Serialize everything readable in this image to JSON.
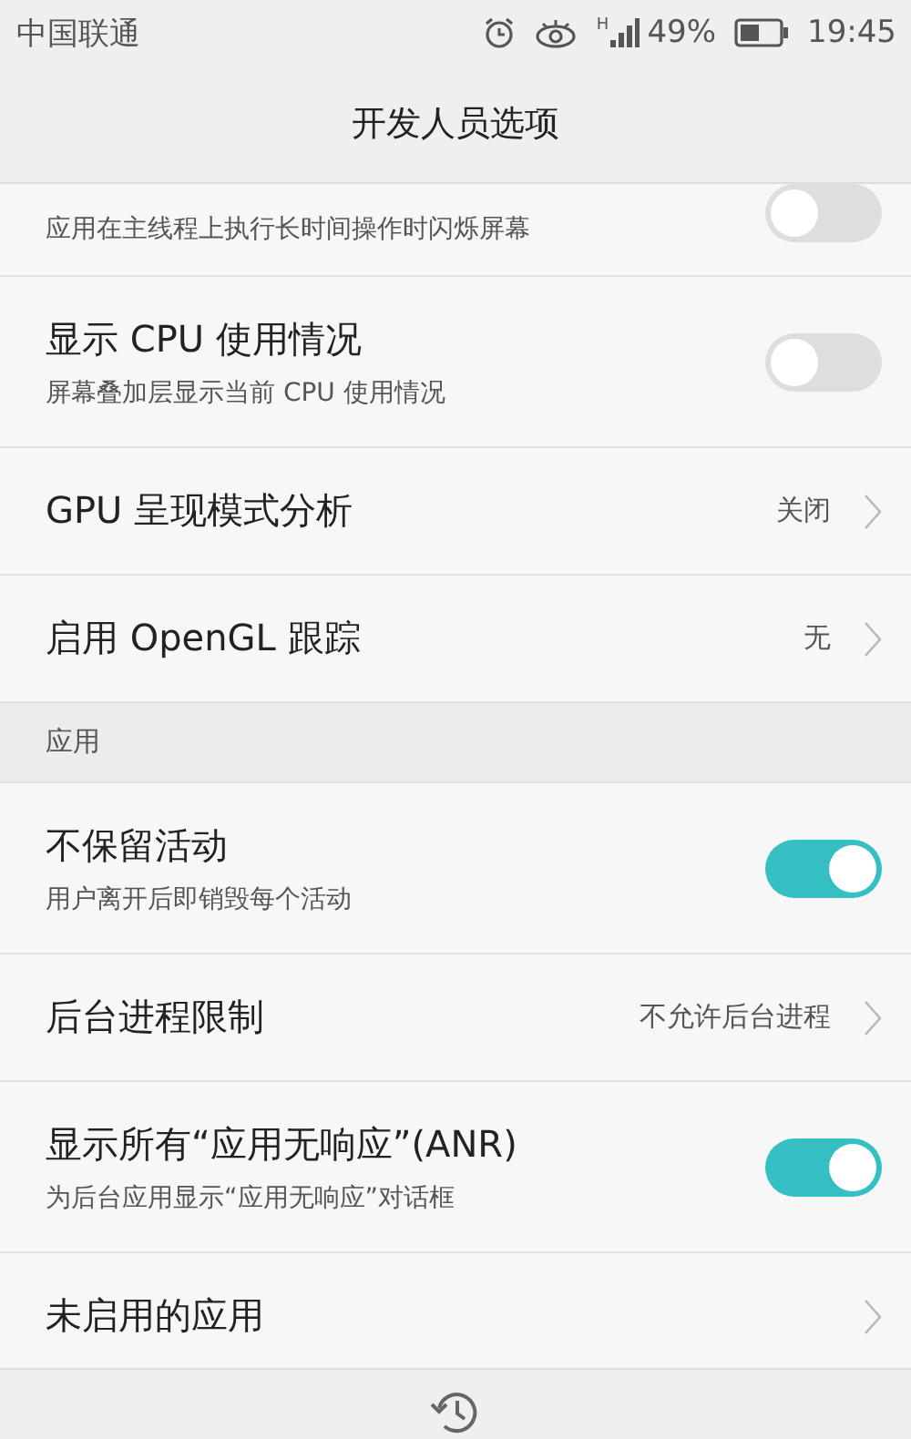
{
  "status_bar": {
    "carrier": "中国联通",
    "network_type": "H",
    "battery": "49%",
    "time": "19:45"
  },
  "title": "开发人员选项",
  "rows": [
    {
      "kind": "switch",
      "subtitle": "应用在主线程上执行长时间操作时闪烁屏幕",
      "on": false
    },
    {
      "kind": "switch",
      "title": "显示 CPU 使用情况",
      "subtitle": "屏幕叠加层显示当前 CPU 使用情况",
      "on": false
    },
    {
      "kind": "link",
      "title": "GPU 呈现模式分析",
      "value": "关闭"
    },
    {
      "kind": "link",
      "title": "启用 OpenGL 跟踪",
      "value": "无"
    },
    {
      "kind": "header",
      "title": "应用"
    },
    {
      "kind": "switch",
      "title": "不保留活动",
      "subtitle": "用户离开后即销毁每个活动",
      "on": true
    },
    {
      "kind": "link",
      "title": "后台进程限制",
      "value": "不允许后台进程"
    },
    {
      "kind": "switch",
      "title": "显示所有“应用无响应”(ANR)",
      "subtitle": "为后台应用显示“应用无响应”对话框",
      "on": true
    },
    {
      "kind": "link",
      "title": "未启用的应用"
    }
  ]
}
